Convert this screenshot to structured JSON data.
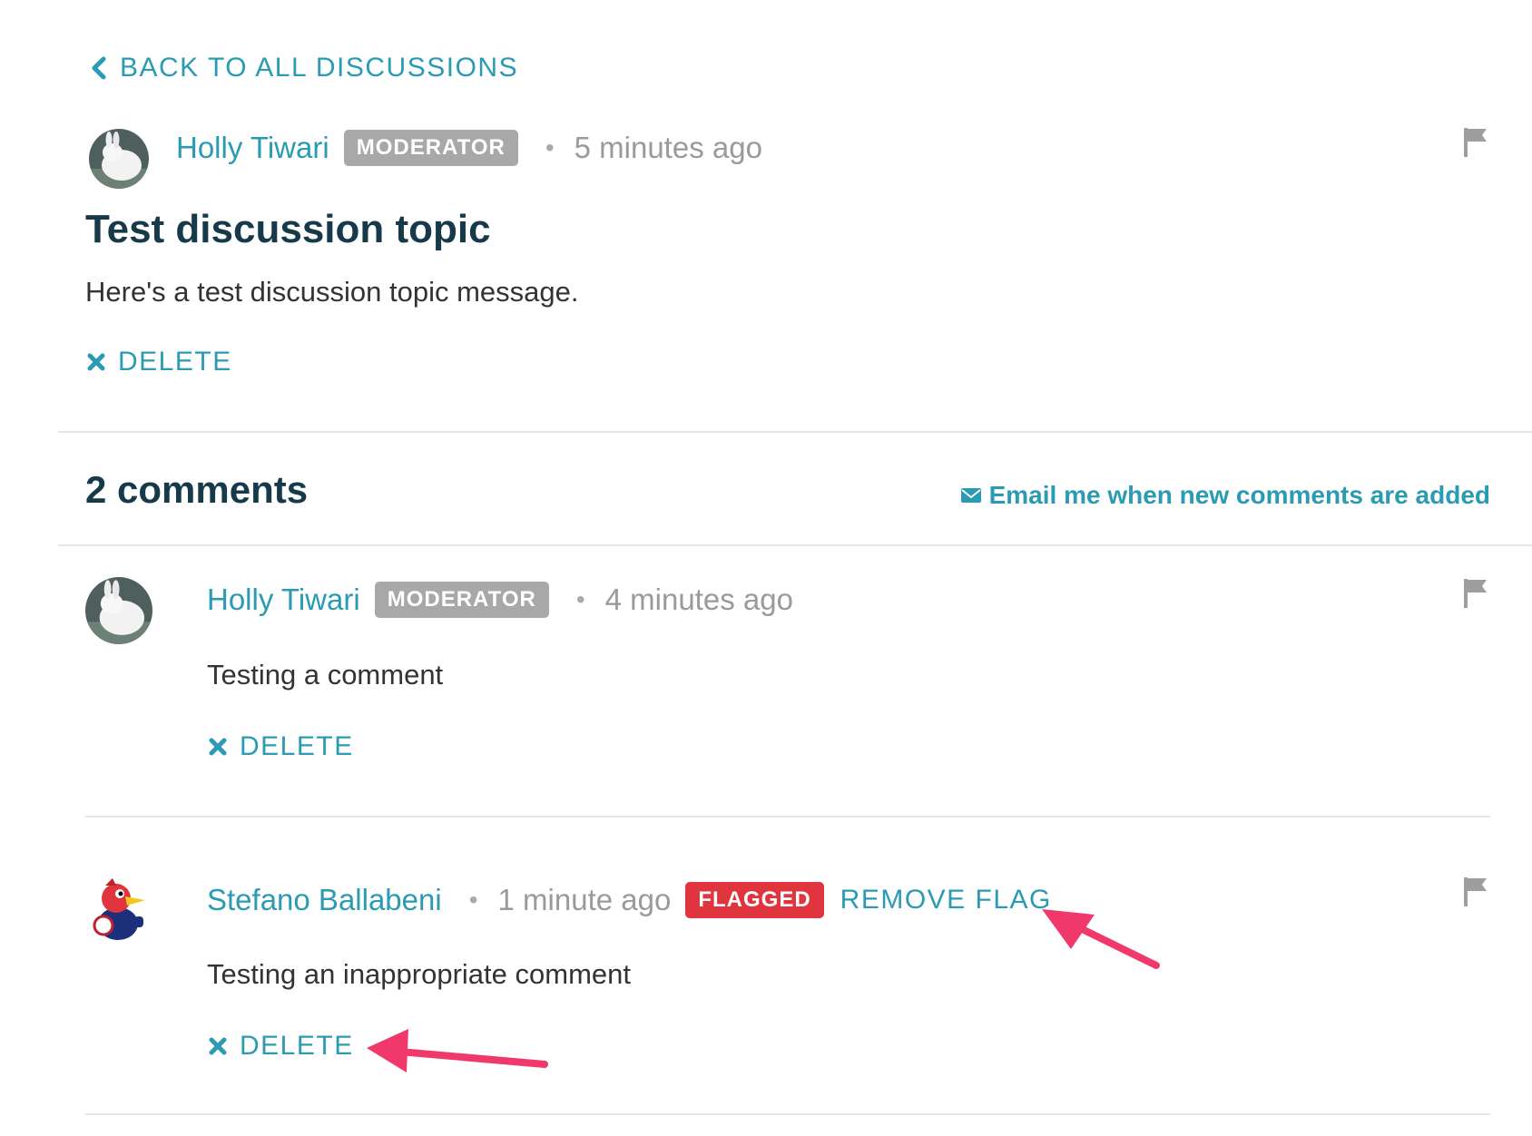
{
  "nav": {
    "back_label": "BACK TO ALL DISCUSSIONS"
  },
  "topic": {
    "author": "Holly Tiwari",
    "role_badge": "MODERATOR",
    "time": "5 minutes ago",
    "title": "Test discussion topic",
    "message": "Here's a test discussion topic message.",
    "delete_label": "DELETE"
  },
  "comments_header": {
    "count_label": "2 comments",
    "email_label": "Email me when new comments are added"
  },
  "comments": [
    {
      "author": "Holly Tiwari",
      "role_badge": "MODERATOR",
      "time": "4 minutes ago",
      "text": "Testing a comment",
      "delete_label": "DELETE"
    },
    {
      "author": "Stefano Ballabeni",
      "time": "1 minute ago",
      "flag_badge": "FLAGGED",
      "remove_flag_label": "REMOVE FLAG",
      "text": "Testing an inappropriate comment",
      "delete_label": "DELETE"
    }
  ],
  "colors": {
    "accent": "#2a9bb3",
    "title": "#173a4b",
    "moderator_badge": "#a8a8a8",
    "flagged_badge": "#e0343f",
    "annotation_arrow": "#f0386b"
  },
  "icons": {
    "back": "chevron-left-icon",
    "delete": "x-icon",
    "flag": "flag-icon",
    "email": "envelope-icon"
  }
}
